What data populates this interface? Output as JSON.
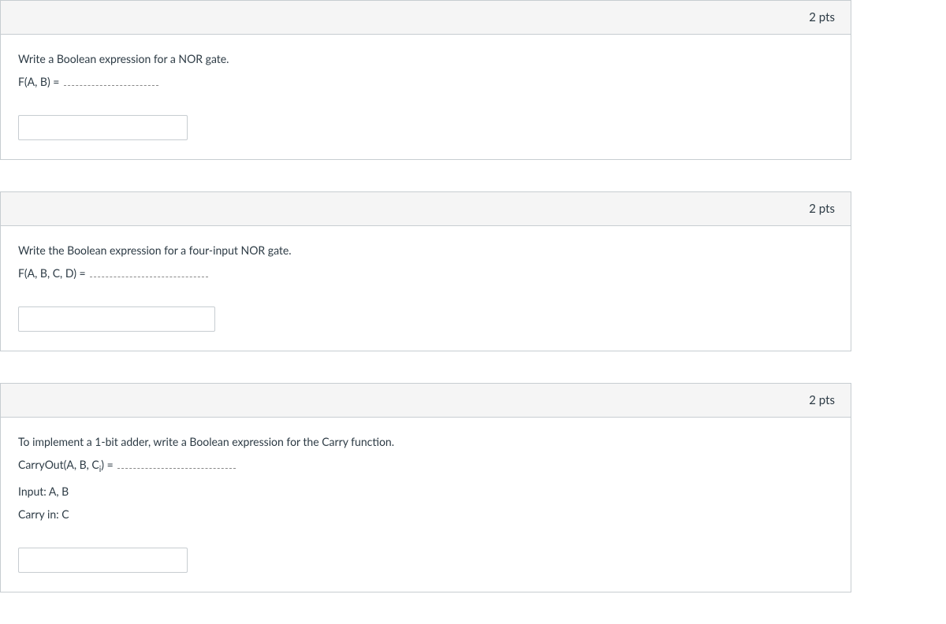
{
  "questions": [
    {
      "points": "2 pts",
      "lines": [
        "Write a Boolean expression for a NOR gate.",
        "F(A, B) ="
      ],
      "blank_after": 1,
      "blank_long": false
    },
    {
      "points": "2 pts",
      "lines": [
        "Write the Boolean expression for a four-input NOR gate.",
        "F(A, B, C, D) ="
      ],
      "blank_after": 1,
      "blank_long": true,
      "input_wide": true
    },
    {
      "points": "2 pts",
      "lines": [
        "To implement a 1-bit adder, write a Boolean expression for the Carry function.",
        "CarryOut(A, B, C<sub>i</sub>) =",
        "Input: A, B",
        "Carry in: C"
      ],
      "blank_after": 1,
      "blank_long": true
    }
  ]
}
